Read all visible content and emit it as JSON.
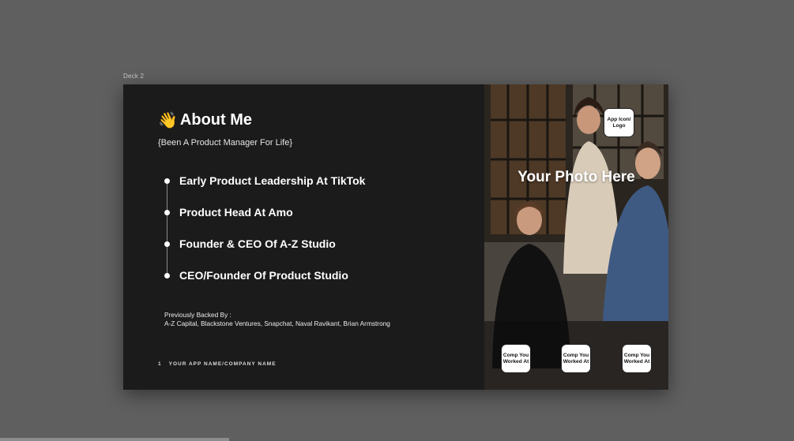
{
  "frame": {
    "label": "Deck 2"
  },
  "slide": {
    "title": "About Me",
    "title_icon": "👋",
    "subtitle": "{Been A Product Manager For Life}",
    "timeline": [
      "Early Product Leadership At TikTok",
      "Product Head At Amo",
      "Founder & CEO Of A-Z Studio",
      "CEO/Founder Of Product Studio"
    ],
    "backers": {
      "heading": "Previously Backed By :",
      "list": "A-Z Capital, Blackstone Ventures, Snapchat, Naval Ravikant, Brian Armstrong"
    },
    "footer": {
      "page_number": "1",
      "company": "YOUR APP NAME/COMPANY NAME"
    },
    "photo": {
      "caption": "Your Photo Here",
      "app_icon": "App Icon/ Logo",
      "companies": [
        "Comp You Worked At",
        "Comp You Worked At",
        "Comp You Worked At"
      ]
    }
  }
}
